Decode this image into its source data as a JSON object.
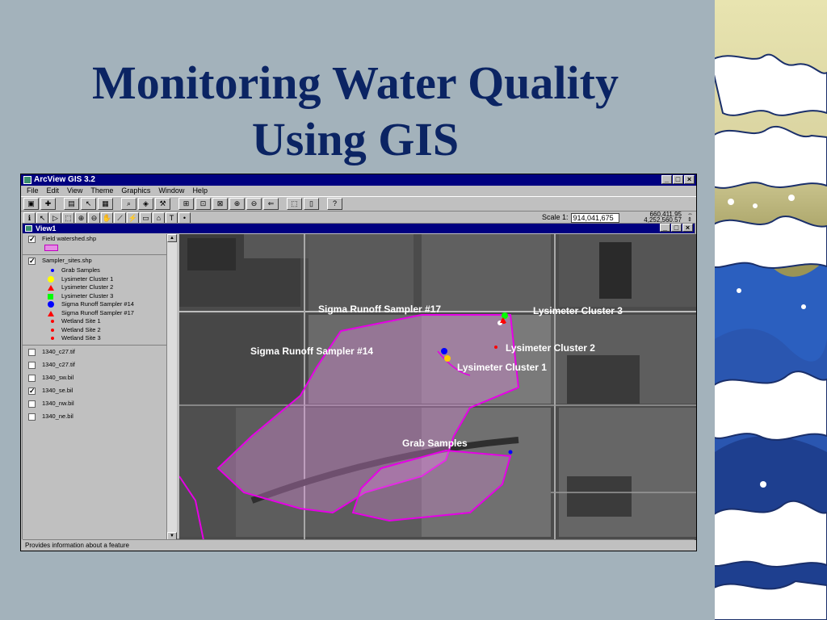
{
  "slide": {
    "title_line1": "Monitoring Water Quality",
    "title_line2": "Using GIS"
  },
  "app": {
    "title": "ArcView GIS 3.2",
    "menu": [
      "File",
      "Edit",
      "View",
      "Theme",
      "Graphics",
      "Window",
      "Help"
    ],
    "scale_label": "Scale 1:",
    "scale_value": "914,041,675",
    "coord_x": "660,411.95",
    "coord_y": "4,252,560.57",
    "status_text": "Provides information about a feature"
  },
  "view": {
    "title": "View1",
    "themes": {
      "field_watershed": "Field watershed.shp",
      "sampler_sites": "Sampler_sites.shp",
      "legend": [
        {
          "label": "Grab Samples",
          "color": "#0000ff",
          "shape": "dot"
        },
        {
          "label": "Lysimeter Cluster 1",
          "color": "#ffff00",
          "shape": "circle"
        },
        {
          "label": "Lysimeter Cluster 2",
          "color": "#ff0000",
          "shape": "triangle"
        },
        {
          "label": "Lysimeter Cluster 3",
          "color": "#00ff00",
          "shape": "square"
        },
        {
          "label": "Sigma Runoff Sampler #14",
          "color": "#0000ff",
          "shape": "circle"
        },
        {
          "label": "Sigma Runoff Sampler #17",
          "color": "#ff0000",
          "shape": "triangle"
        },
        {
          "label": "Wetland Site 1",
          "color": "#ff0000",
          "shape": "dot"
        },
        {
          "label": "Wetland Site 2",
          "color": "#ff0000",
          "shape": "dot"
        },
        {
          "label": "Wetland Site 3",
          "color": "#ff0000",
          "shape": "dot"
        }
      ],
      "rasters": [
        "1340_c27.tif",
        "1340_c27.tif",
        "1340_sw.bil",
        "1340_se.bil",
        "1340_nw.bil",
        "1340_ne.bil"
      ]
    },
    "map_labels": {
      "sigma17": "Sigma Runoff Sampler #17",
      "lys3": "Lysimeter Cluster 3",
      "sigma14": "Sigma Runoff Sampler #14",
      "lys2": "Lysimeter Cluster 2",
      "lys1": "Lysimeter Cluster 1",
      "grab": "Grab Samples"
    }
  }
}
